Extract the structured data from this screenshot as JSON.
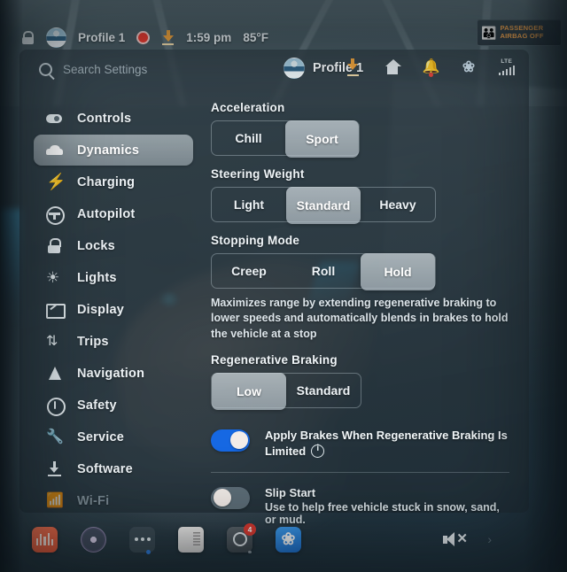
{
  "statusbar": {
    "lock_icon": "unlock-icon",
    "profile_name": "Profile 1",
    "record_icon": "record-dot-icon",
    "download_icon": "download-icon",
    "time": "1:59 pm",
    "temperature": "85°F",
    "airbag_line1": "PASSENGER",
    "airbag_line2": "AIRBAG OFF"
  },
  "header": {
    "search_placeholder": "Search Settings",
    "search_value": "",
    "profile_name": "Profile 1",
    "icons": [
      "download-icon",
      "home-icon",
      "bell-icon",
      "bluetooth-icon"
    ],
    "signal_label": "LTE"
  },
  "sidebar": {
    "items": [
      {
        "label": "Controls",
        "icon": "toggle-icon",
        "active": false,
        "dim": false
      },
      {
        "label": "Dynamics",
        "icon": "car-icon",
        "active": true,
        "dim": false
      },
      {
        "label": "Charging",
        "icon": "bolt-icon",
        "active": false,
        "dim": false
      },
      {
        "label": "Autopilot",
        "icon": "steering-wheel-icon",
        "active": false,
        "dim": false
      },
      {
        "label": "Locks",
        "icon": "lock-icon",
        "active": false,
        "dim": false
      },
      {
        "label": "Lights",
        "icon": "sun-icon",
        "active": false,
        "dim": false
      },
      {
        "label": "Display",
        "icon": "display-icon",
        "active": false,
        "dim": false
      },
      {
        "label": "Trips",
        "icon": "trips-icon",
        "active": false,
        "dim": false
      },
      {
        "label": "Navigation",
        "icon": "navigation-arrow-icon",
        "active": false,
        "dim": false
      },
      {
        "label": "Safety",
        "icon": "info-circle-icon",
        "active": false,
        "dim": false
      },
      {
        "label": "Service",
        "icon": "wrench-icon",
        "active": false,
        "dim": false
      },
      {
        "label": "Software",
        "icon": "download-icon",
        "active": false,
        "dim": false
      },
      {
        "label": "Wi-Fi",
        "icon": "wifi-icon",
        "active": false,
        "dim": true
      }
    ]
  },
  "main": {
    "acceleration": {
      "title": "Acceleration",
      "options": [
        {
          "label": "Chill",
          "selected": false
        },
        {
          "label": "Sport",
          "selected": true
        }
      ]
    },
    "steering_weight": {
      "title": "Steering Weight",
      "options": [
        {
          "label": "Light",
          "selected": false
        },
        {
          "label": "Standard",
          "selected": true
        },
        {
          "label": "Heavy",
          "selected": false
        }
      ]
    },
    "stopping_mode": {
      "title": "Stopping Mode",
      "options": [
        {
          "label": "Creep",
          "selected": false
        },
        {
          "label": "Roll",
          "selected": false
        },
        {
          "label": "Hold",
          "selected": true
        }
      ],
      "description": "Maximizes range by extending regenerative braking to lower speeds and automatically blends in brakes to hold the vehicle at a stop"
    },
    "regenerative_braking": {
      "title": "Regenerative Braking",
      "options": [
        {
          "label": "Low",
          "selected": true
        },
        {
          "label": "Standard",
          "selected": false
        }
      ]
    },
    "apply_brakes": {
      "label": "Apply Brakes When Regenerative Braking Is Limited",
      "toggle_on": true,
      "info_icon": "info-icon"
    },
    "slip_start": {
      "label": "Slip Start",
      "description": "Use to help free vehicle stuck in snow, sand, or mud.",
      "toggle_on": false
    }
  },
  "taskbar": {
    "icons": [
      {
        "name": "audio-app-icon",
        "badge": ""
      },
      {
        "name": "volume-knob-icon",
        "badge": ""
      },
      {
        "name": "more-options-icon",
        "badge": ""
      },
      {
        "name": "card-app-icon",
        "badge": ""
      },
      {
        "name": "camera-app-icon",
        "badge": "4"
      },
      {
        "name": "bluetooth-app-icon",
        "badge": ""
      }
    ],
    "mute_icon": "volume-muted-icon",
    "chevron": "›"
  },
  "colors": {
    "accent_blue": "#1668e3",
    "selected_segment": "#c8d1d6",
    "warning_orange": "#f2a24a",
    "record_red": "#e8372d",
    "badge_red": "#e0392f"
  }
}
